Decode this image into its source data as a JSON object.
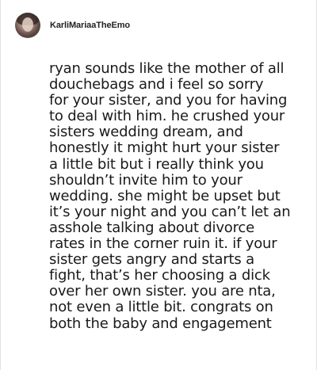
{
  "comment": {
    "username": "KarliMariaaTheEmo",
    "lines": [
      "ryan sounds like the mother of all",
      "douchebags and i feel so sorry",
      "for your sister, and you for having",
      "to deal with him. he crushed your",
      "sisters wedding dream, and",
      "honestly it might hurt your sister",
      "a little bit but i really think you",
      "shouldn’t invite him to your",
      "wedding. she might be upset but",
      "it’s your night and you can’t let an",
      "asshole talking about divorce",
      "rates in the corner ruin it. if your",
      "sister gets angry and starts a",
      "fight, that’s her choosing a dick",
      "over her own sister. you are nta,",
      "not even a little bit. congrats on",
      "both the baby and engagement"
    ]
  }
}
